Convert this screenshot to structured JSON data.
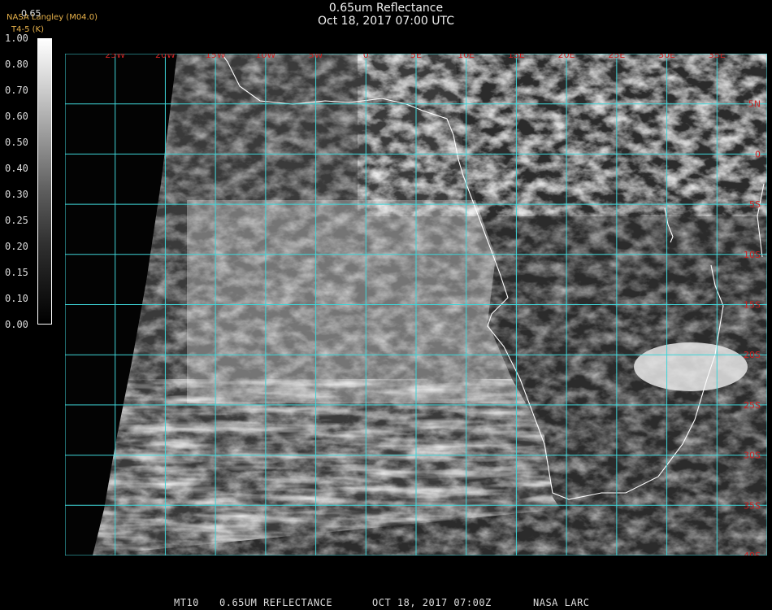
{
  "header": {
    "title": "0.65um Reflectance",
    "subtitle": "Oct 18, 2017 07:00 UTC",
    "provider": "NASA Langley (M04.0)",
    "sublabel": "T4-5 (K)",
    "scale_top_label": "0.65"
  },
  "colorbar": {
    "ticks": [
      "1.00",
      "0.80",
      "0.70",
      "0.60",
      "0.50",
      "0.40",
      "0.30",
      "0.25",
      "0.20",
      "0.15",
      "0.10",
      "0.00"
    ]
  },
  "map": {
    "grid_color": "#3fd5d8",
    "label_color": "#cc2222",
    "lon_labels": [
      "25W",
      "20W",
      "15W",
      "10W",
      "5W",
      "0",
      "5E",
      "10E",
      "15E",
      "20E",
      "25E",
      "30E",
      "35E"
    ],
    "lat_labels": [
      "5N",
      "0",
      "5S",
      "10S",
      "15S",
      "20S",
      "25S",
      "30S",
      "35S",
      "40S"
    ]
  },
  "footer": {
    "product": "MT10",
    "channel": "0.65UM REFLECTANCE",
    "datetime": "OCT 18, 2017 07:00Z",
    "source": "NASA LARC"
  }
}
